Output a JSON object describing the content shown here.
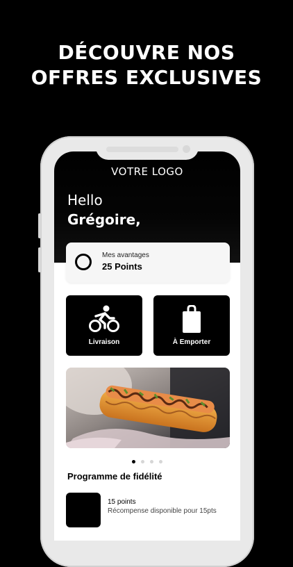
{
  "headline": {
    "line1": "DÉCOUVRE NOS",
    "line2": "OFFRES EXCLUSIVES"
  },
  "app": {
    "logo_text": "VOTRE LOGO",
    "greeting": "Hello",
    "user_name": "Grégoire,",
    "points_card": {
      "label": "Mes avantages",
      "value": "25 Points",
      "icon": "ring-icon"
    },
    "actions": [
      {
        "label": "Livraison",
        "icon": "cyclist-icon"
      },
      {
        "label": "À Emporter",
        "icon": "shopping-bag-icon"
      }
    ],
    "carousel": {
      "slides": 4,
      "active_index": 0,
      "image": "food-hotdog-photo"
    },
    "loyalty": {
      "title": "Programme de fidélité",
      "items": [
        {
          "points": "15 points",
          "description": "Récompense disponible pour 15pts"
        }
      ]
    }
  },
  "colors": {
    "background": "#000000",
    "phone_frame": "#e9e9e9",
    "accent": "#000000",
    "card": "#f6f6f6"
  }
}
